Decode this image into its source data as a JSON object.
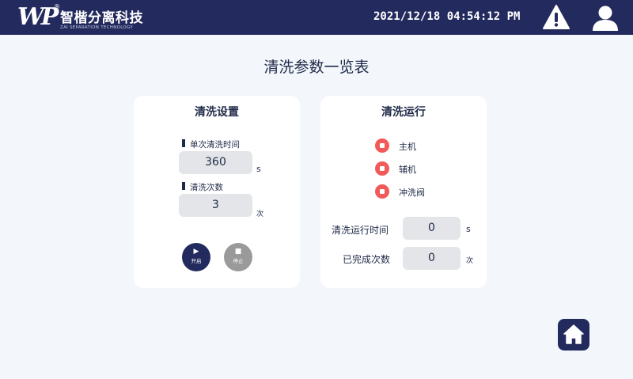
{
  "header": {
    "logo_mark": "WP",
    "logo_reg": "®",
    "company_name": "智楷分离科技",
    "company_sub": "ZAI SEPARATION TECHNOLOGY",
    "datetime": "2021/12/18 04:54:12 PM",
    "alert_icon": "warning-icon",
    "user_icon": "user-icon"
  },
  "page": {
    "title": "清洗参数一览表"
  },
  "settings": {
    "title": "清洗设置",
    "single_time_label": "单次清洗时间",
    "single_time_value": "360",
    "single_time_unit": "s",
    "count_label": "清洗次数",
    "count_value": "3",
    "count_unit": "次",
    "start_label": "开启",
    "start_icon": "play-icon",
    "stop_label": "停止",
    "stop_icon": "stop-icon"
  },
  "running": {
    "title": "清洗运行",
    "indicators": [
      {
        "label": "主机",
        "color": "#f25a5a"
      },
      {
        "label": "辅机",
        "color": "#f25a5a"
      },
      {
        "label": "冲洗阀",
        "color": "#f25a5a"
      }
    ],
    "run_time_label": "清洗运行时间",
    "run_time_value": "0",
    "run_time_unit": "s",
    "done_label": "已完成次数",
    "done_value": "0",
    "done_unit": "次"
  },
  "footer": {
    "home_icon": "home-icon"
  },
  "colors": {
    "brand": "#232a5e",
    "background": "#f3f7fc",
    "indicator_off": "#f25a5a",
    "stop_button": "#9a9a9a"
  }
}
